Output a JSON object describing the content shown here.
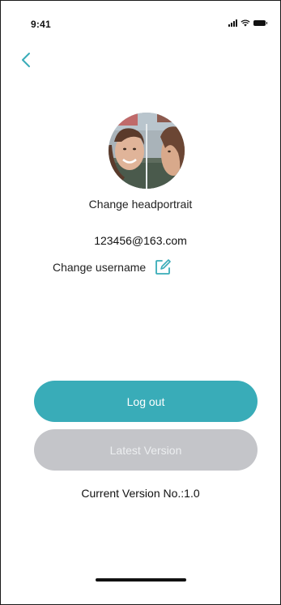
{
  "status_bar": {
    "time": "9:41"
  },
  "nav": {
    "back_icon": "chevron-left-icon"
  },
  "profile": {
    "change_headportrait_label": "Change headportrait",
    "email": "123456@163.com",
    "change_username_label": "Change username",
    "edit_icon": "edit-icon"
  },
  "actions": {
    "logout_label": "Log out",
    "latest_version_label": "Latest Version"
  },
  "footer": {
    "current_version_text": "Current Version No.:1.0"
  },
  "colors": {
    "accent": "#39acb8",
    "disabled_button": "#c4c5c9",
    "text": "#111111"
  }
}
